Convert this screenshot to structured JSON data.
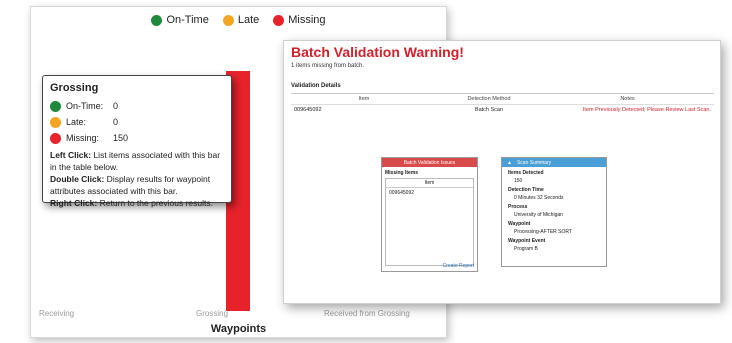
{
  "legend": [
    {
      "label": "On-Time",
      "color": "#1f8a3b"
    },
    {
      "label": "Late",
      "color": "#f4a623"
    },
    {
      "label": "Missing",
      "color": "#e8222b"
    }
  ],
  "chart_data": {
    "type": "bar",
    "categories": [
      "Receiving",
      "Grossing",
      "Received from Grossing"
    ],
    "series": [
      {
        "name": "On-Time",
        "values": [
          null,
          0,
          null
        ]
      },
      {
        "name": "Late",
        "values": [
          null,
          0,
          null
        ]
      },
      {
        "name": "Missing",
        "values": [
          null,
          150,
          null
        ]
      }
    ],
    "title": "",
    "xlabel": "Waypoints",
    "ylabel": ""
  },
  "tooltip": {
    "title": "Grossing",
    "rows": [
      {
        "label": "On-Time:",
        "value": "0"
      },
      {
        "label": "Late:",
        "value": "0"
      },
      {
        "label": "Missing:",
        "value": "150"
      }
    ],
    "help": [
      {
        "key": "Left Click:",
        "text": " List items associated with this bar in the table below."
      },
      {
        "key": "Double Click:",
        "text": " Display results for waypoint attributes associated with this bar."
      },
      {
        "key": "Right Click:",
        "text": " Return to the previous results."
      }
    ]
  },
  "warning": {
    "title": "Batch Validation Warning!",
    "subtitle": "1 items missing from batch.",
    "details_title": "Validation Details",
    "columns": [
      "Item",
      "Detection Method",
      "Notes"
    ],
    "rows": [
      {
        "item": "009645092",
        "method": "Batch Scan",
        "notes": "Item Previously Detected; Please Review Last Scan."
      }
    ]
  },
  "batch_issues": {
    "header": "Batch Validation Issues",
    "section": "Missing Items",
    "column": "Item",
    "items": [
      "009645092"
    ],
    "link": "Create Report"
  },
  "scan_summary": {
    "header": "Scan Summary",
    "fields": [
      {
        "label": "Items Detected",
        "value": "150"
      },
      {
        "label": "Detection Time",
        "value": "0 Minutes 32 Seconds"
      },
      {
        "label": "Process",
        "value": "University of Michigan"
      },
      {
        "label": "Waypoint",
        "value": "Processing-AFTER SORT"
      },
      {
        "label": "Waypoint Event",
        "value": "Program B"
      }
    ]
  }
}
